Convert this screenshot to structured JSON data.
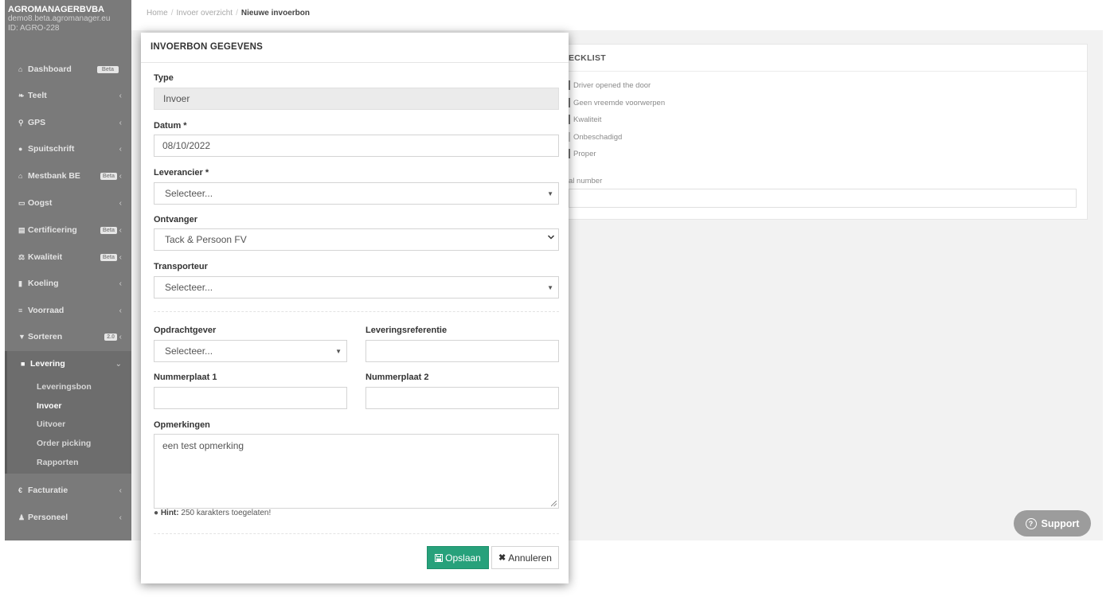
{
  "sidebar": {
    "company": "AGROMANAGERBVBA",
    "domain": "demo8.beta.agromanager.eu",
    "id": "ID: AGRO-228",
    "items": [
      {
        "label": "Dashboard",
        "icon": "home-icon",
        "badge": "Beta"
      },
      {
        "label": "Teelt",
        "icon": "leaf-icon"
      },
      {
        "label": "GPS",
        "icon": "map-marker-icon"
      },
      {
        "label": "Spuitschrift",
        "icon": "drop-icon"
      },
      {
        "label": "Mestbank BE",
        "icon": "bank-icon",
        "badge": "Beta"
      },
      {
        "label": "Oogst",
        "icon": "basket-icon"
      },
      {
        "label": "Certificering",
        "icon": "certificate-icon",
        "badge": "Beta"
      },
      {
        "label": "Kwaliteit",
        "icon": "balance-icon",
        "badge": "Beta"
      },
      {
        "label": "Koeling",
        "icon": "thermometer-icon"
      },
      {
        "label": "Voorraad",
        "icon": "list-icon"
      },
      {
        "label": "Sorteren",
        "icon": "filter-icon",
        "badge": "2.0"
      },
      {
        "label": "Levering",
        "icon": "truck-icon"
      },
      {
        "label": "Facturatie",
        "icon": "euro-icon"
      },
      {
        "label": "Personeel",
        "icon": "user-icon"
      }
    ],
    "subitems": [
      "Leveringsbon",
      "Invoer",
      "Uitvoer",
      "Order picking",
      "Rapporten"
    ]
  },
  "breadcrumb": {
    "home": "Home",
    "overview": "Invoer overzicht",
    "current": "Nieuwe invoerbon"
  },
  "checklist": {
    "title": "ECKLIST",
    "items": [
      "Driver opened the door",
      "Geen vreemde voorwerpen",
      "Kwaliteit",
      "Onbeschadigd",
      "Proper"
    ],
    "serial_label": "al number"
  },
  "support": {
    "label": "Support"
  },
  "modal": {
    "title": "INVOERBON GEGEVENS",
    "type_label": "Type",
    "type_value": "Invoer",
    "datum_label": "Datum *",
    "datum_value": "08/10/2022",
    "leverancier_label": "Leverancier *",
    "leverancier_value": "Selecteer...",
    "ontvanger_label": "Ontvanger",
    "ontvanger_value": "Tack & Persoon FV",
    "transporteur_label": "Transporteur",
    "transporteur_value": "Selecteer...",
    "opdrachtgever_label": "Opdrachtgever",
    "opdrachtgever_value": "Selecteer...",
    "leveringsreferentie_label": "Leveringsreferentie",
    "leveringsreferentie_value": "",
    "nummerplaat1_label": "Nummerplaat 1",
    "nummerplaat1_value": "",
    "nummerplaat2_label": "Nummerplaat 2",
    "nummerplaat2_value": "",
    "opmerkingen_label": "Opmerkingen",
    "opmerkingen_value": "een test opmerking",
    "hint_label": "Hint:",
    "hint_text": "250 karakters toegelaten!",
    "save_label": "Opslaan",
    "cancel_label": "Annuleren"
  },
  "colors": {
    "sidebar": "#7a7a7a",
    "primary": "#27a17b",
    "support": "#9c9c9c"
  }
}
